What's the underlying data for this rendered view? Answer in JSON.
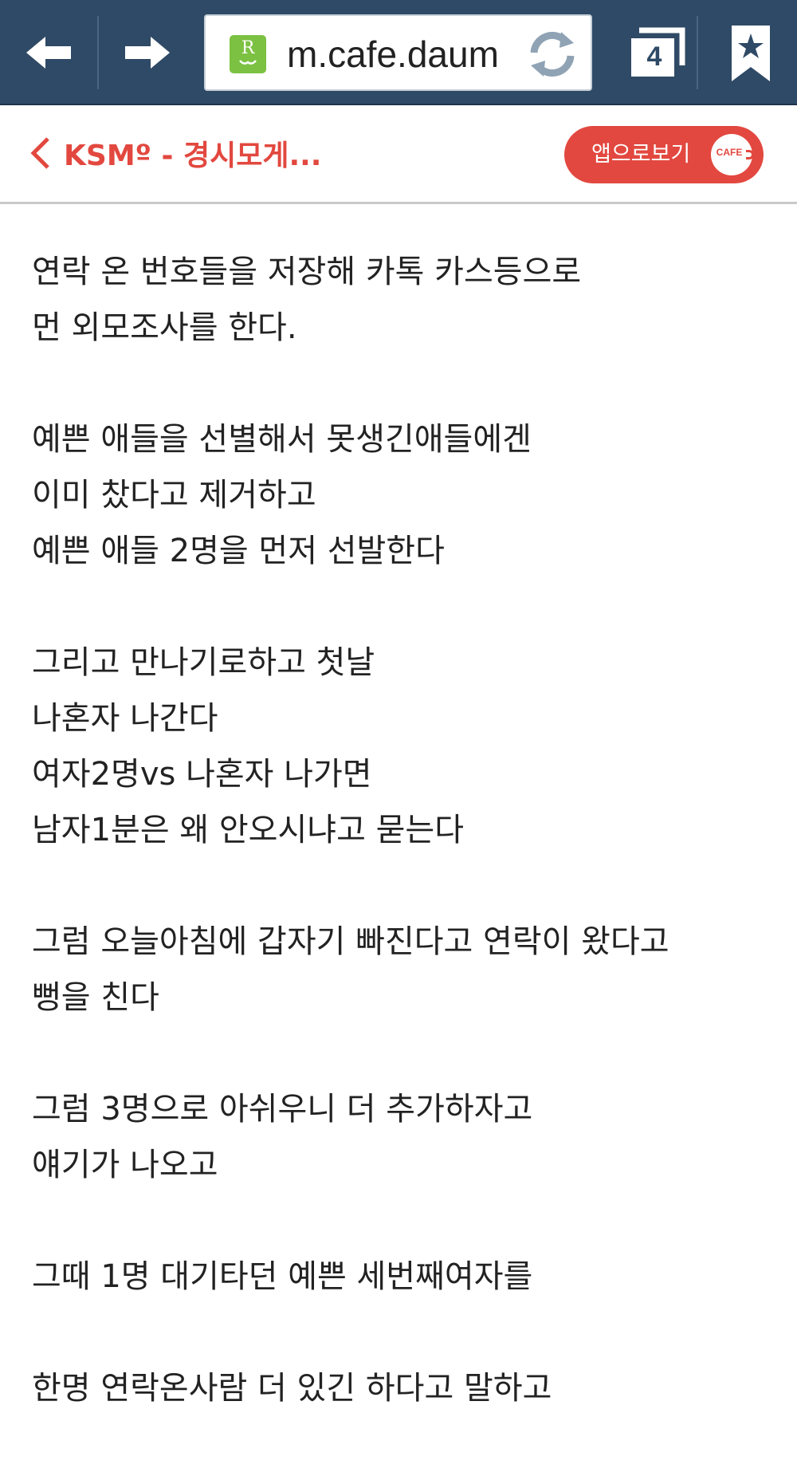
{
  "browser": {
    "url": "m.cafe.daum",
    "site_icon_letter": "R",
    "tab_count": "4",
    "icons": {
      "back": "arrow-left-icon",
      "forward": "arrow-right-icon",
      "reload": "reload-icon",
      "tabs": "tabs-icon",
      "bookmark": "bookmark-star-icon"
    },
    "colors": {
      "toolbar": "#2f4a66",
      "site_icon": "#7cc142",
      "reload": "#8fa3b5"
    }
  },
  "header": {
    "title": "KSMº - 경시모게...",
    "app_button_label": "앱으로보기",
    "cafe_badge": "CAFE",
    "accent_color": "#e2483f"
  },
  "article": {
    "paragraphs": [
      [
        "연락 온 번호들을 저장해 카톡 카스등으로",
        "먼 외모조사를 한다."
      ],
      [
        "예쁜 애들을 선별해서 못생긴애들에겐",
        "이미 찼다고 제거하고",
        "예쁜 애들 2명을 먼저 선발한다"
      ],
      [
        "그리고 만나기로하고 첫날",
        "나혼자 나간다",
        "여자2명vs 나혼자 나가면",
        "남자1분은 왜 안오시냐고 묻는다"
      ],
      [
        "그럼 오늘아침에 갑자기 빠진다고 연락이 왔다고",
        "뻥을 친다"
      ],
      [
        "그럼 3명으로 아쉬우니 더 추가하자고",
        "얘기가 나오고"
      ],
      [
        "그때 1명 대기타던 예쁜 세번째여자를"
      ],
      [
        "한명 연락온사람 더 있긴 하다고 말하고"
      ]
    ]
  }
}
